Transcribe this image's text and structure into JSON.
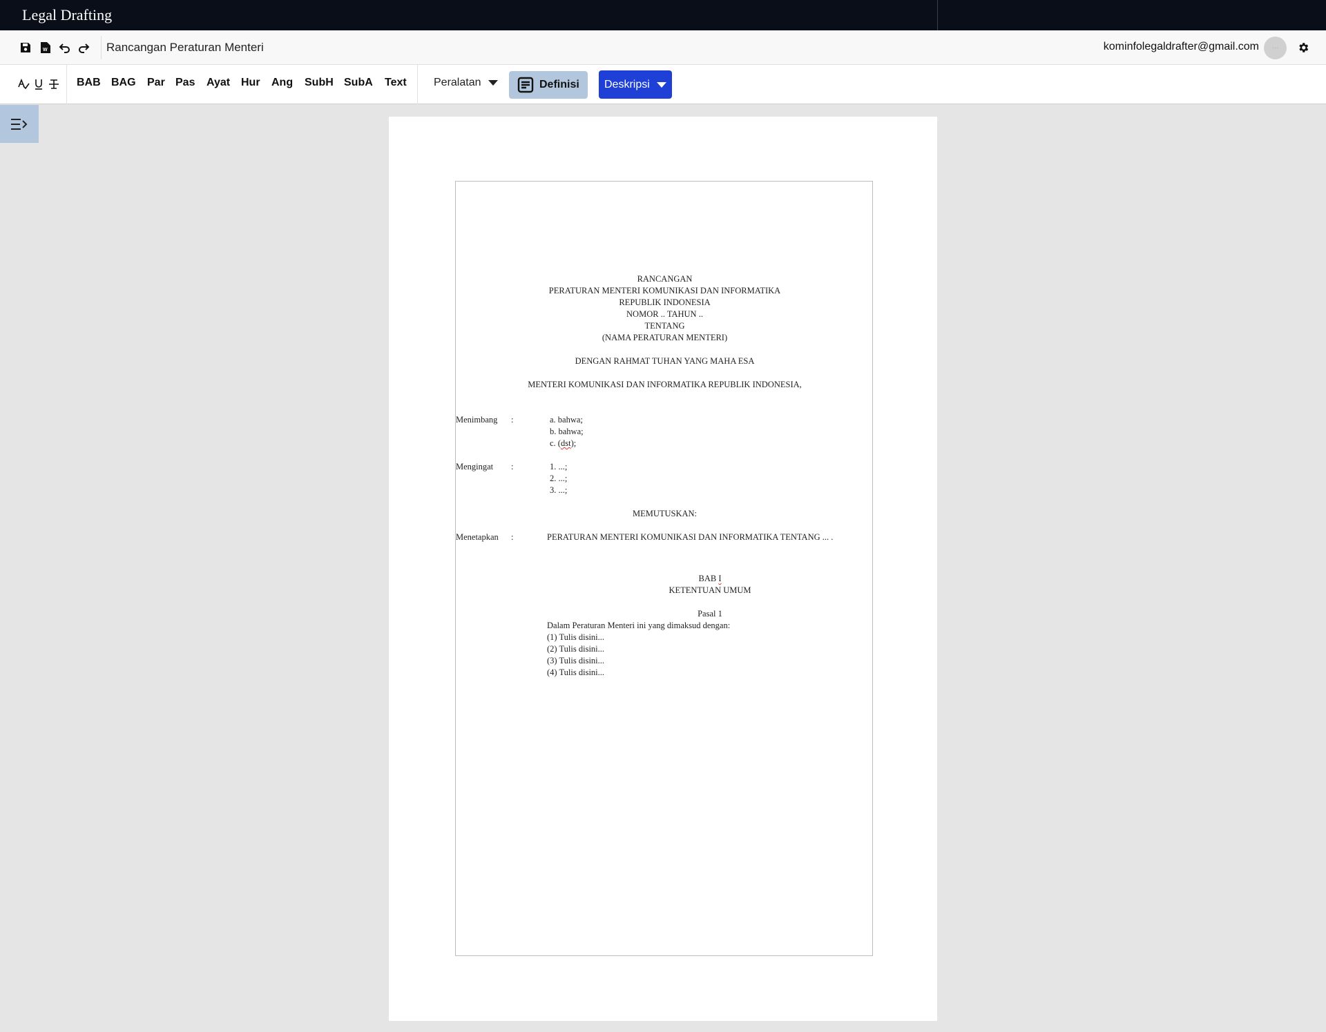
{
  "app": {
    "title": "Legal Drafting"
  },
  "menubar": {
    "document_name": "Rancangan Peraturan Menteri",
    "user_email": "kominfolegaldrafter@gmail.com",
    "avatar_text": "···",
    "icons": [
      "save-icon",
      "export-word-icon",
      "undo-icon",
      "redo-icon",
      "gear-icon"
    ]
  },
  "toolbar": {
    "format_icons": [
      "spellcheck-icon",
      "underline-icon",
      "strikethrough-icon"
    ],
    "buttons": [
      "BAB",
      "BAG",
      "Par",
      "Pas",
      "Ayat",
      "Hur",
      "Ang",
      "SubH",
      "SubA",
      "Text"
    ],
    "peralatan_label": "Peralatan",
    "definisi_label": "Definisi",
    "deskripsi_label": "Deskripsi",
    "colors": {
      "definisi_bg": "#b2c7de",
      "deskripsi_bg": "#1e40d6"
    }
  },
  "document": {
    "heading_lines": [
      "RANCANGAN",
      "PERATURAN MENTERI KOMUNIKASI DAN INFORMATIKA",
      "REPUBLIK INDONESIA",
      "NOMOR .. TAHUN ..",
      "TENTANG",
      "(NAMA PERATURAN MENTERI)"
    ],
    "rahmat": "DENGAN RAHMAT TUHAN YANG MAHA ESA",
    "menteri": "MENTERI KOMUNIKASI DAN INFORMATIKA REPUBLIK INDONESIA,",
    "menimbang_label": "Menimbang",
    "colon": ":",
    "menimbang_items": [
      "a. bahwa;",
      "b. bahwa;"
    ],
    "menimbang_c_prefix": "c. (",
    "menimbang_c_word": "dst",
    "menimbang_c_suffix": ");",
    "mengingat_label": "Mengingat",
    "mengingat_items": [
      "1. ...;",
      "2. ...;",
      "3. ...;"
    ],
    "memutuskan": "MEMUTUSKAN:",
    "menetapkan_label": "Menetapkan",
    "menetapkan_text": "PERATURAN MENTERI KOMUNIKASI DAN INFORMATIKA TENTANG ... .",
    "bab_prefix": "BAB ",
    "bab_number": "I",
    "bab_title": "KETENTUAN UMUM",
    "pasal": "Pasal 1",
    "pasal_intro": "Dalam Peraturan Menteri ini yang dimaksud dengan:",
    "pasal_items": [
      "(1) Tulis disini...",
      "(2) Tulis disini...",
      "(3) Tulis disini...",
      "(4) Tulis disini..."
    ]
  }
}
